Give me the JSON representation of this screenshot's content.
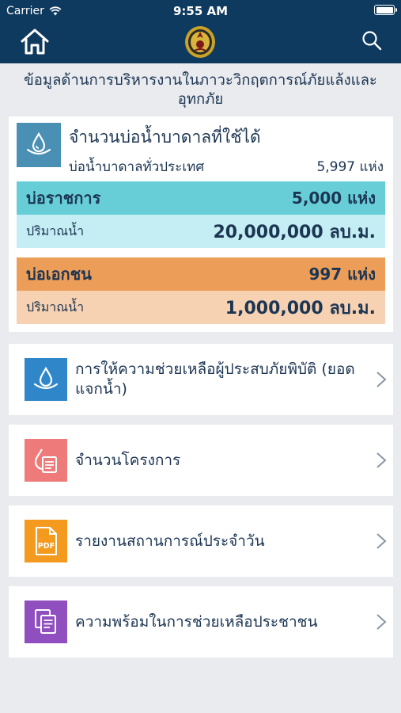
{
  "status": {
    "carrier": "Carrier",
    "time": "9:55 AM"
  },
  "colors": {
    "nav": "#0f3a5f",
    "gov_header": "#67ced8",
    "gov_value": "#c4eef3",
    "private_header": "#ec9e58",
    "private_value": "#f6d1b2"
  },
  "nav": {
    "home_icon": "home-icon",
    "logo_icon": "emblem-logo-icon",
    "search_icon": "search-icon"
  },
  "heading": "ข้อมูลด้านการบริหารงานในภาวะวิกฤตการณ์ภัยแล้งและอุทกภัย",
  "wells": {
    "title": "จำนวนบ่อน้ำบาดาลที่ใช้ได้",
    "national_label": "บ่อน้ำบาดาลทั่วประเทศ",
    "national_value": "5,997 แห่ง",
    "gov": {
      "label": "บ่อราชการ",
      "count": "5,000 แห่ง",
      "volume_label": "ปริมาณน้ำ",
      "volume": "20,000,000 ลบ.ม."
    },
    "private": {
      "label": "บ่อเอกชน",
      "count": "997 แห่ง",
      "volume_label": "ปริมาณน้ำ",
      "volume": "1,000,000 ลบ.ม."
    }
  },
  "menu": [
    {
      "label": "การให้ความช่วยเหลือผู้ประสบภัยพิบัติ (ยอดแจกน้ำ)",
      "icon": "water-drop-icon",
      "color": "#2f86c9"
    },
    {
      "label": "จำนวนโครงการ",
      "icon": "project-document-icon",
      "color": "#ee7a7a"
    },
    {
      "label": "รายงานสถานการณ์ประจำวัน",
      "icon": "pdf-file-icon",
      "color": "#f39a1f",
      "icon_text": "PDF"
    },
    {
      "label": "ความพร้อมในการช่วยเหลือประชาชน",
      "icon": "copy-documents-icon",
      "color": "#8f4fbf"
    }
  ]
}
